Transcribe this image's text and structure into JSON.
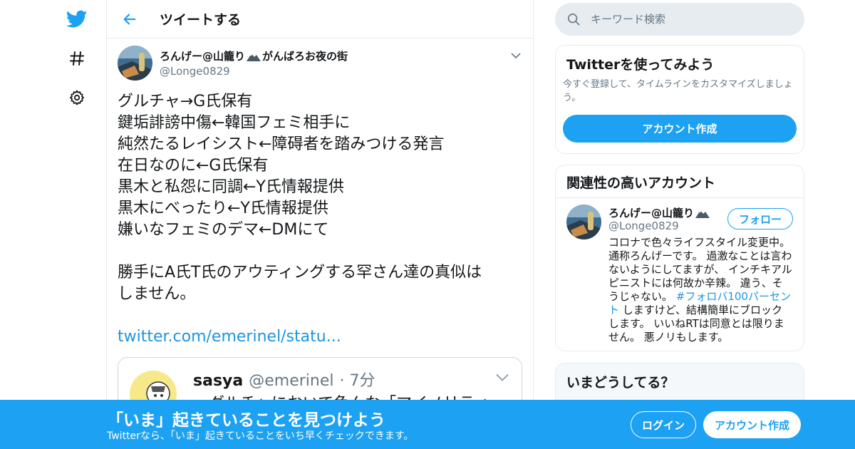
{
  "nav": {
    "logo_icon": "twitter-bird-icon",
    "explore_icon": "hash-icon",
    "settings_icon": "gear-icon"
  },
  "header": {
    "back_icon": "arrow-left-icon",
    "title": "ツイートする"
  },
  "tweet": {
    "author_name": "ろんげー@山籠り",
    "author_name_suffix": "がんばろお夜の街",
    "author_emoji_icon": "mountain-snow-icon",
    "author_handle": "@Longe0829",
    "body": "グルチャ→G氏保有\n鍵垢誹謗中傷←韓国フェミ相手に\n純然たるレイシスト←障碍者を踏みつける発言\n在日なのに←G氏保有\n黒木と私怨に同調←Y氏情報提供\n黒木にべったり←Y氏情報提供\n嫌いなフェミのデマ←DMにて\n\n勝手にA氏T氏のアウティングする罕さん達の真似は\nしません。",
    "link": "twitter.com/emerinel/statu...",
    "quote": {
      "name": "sasya",
      "handle": "@emerinel",
      "time": "· 7分",
      "text": "・グルチャにおいて色んな「マイノリティ"
    }
  },
  "search": {
    "placeholder": "キーワード検索"
  },
  "try_card": {
    "title": "Twitterを使ってみよう",
    "description": "今すぐ登録して、タイムラインをカスタマイズしましょう。",
    "button": "アカウント作成"
  },
  "related_card": {
    "title": "関連性の高いアカウント",
    "name": "ろんげー@山籠り",
    "handle": "@Longe0829",
    "follow_button": "フォロー",
    "bio_before": "コロナで色々ライフスタイル変更中。通称ろんげーです。 過激なことは言わないようにしてますが、 インチキアルピニストには何故か辛辣。 違う、そうじゃない。 ",
    "bio_hashtag": "#フォロバ100パーセント",
    "bio_after": " しますけど、結構簡単にブロックします。 いいねRTは同意とは限りません。 悪ノリもします。"
  },
  "now_card": {
    "title": "いまどうしてる？"
  },
  "banner": {
    "title": "「いま」起きていることを見つけよう",
    "subtitle": "Twitterなら、「いま」起きていることをいち早くチェックできます。",
    "login": "ログイン",
    "signup": "アカウント作成"
  },
  "colors": {
    "brand": "#1da1f2",
    "link": "#1b95e0",
    "muted": "#657786"
  }
}
